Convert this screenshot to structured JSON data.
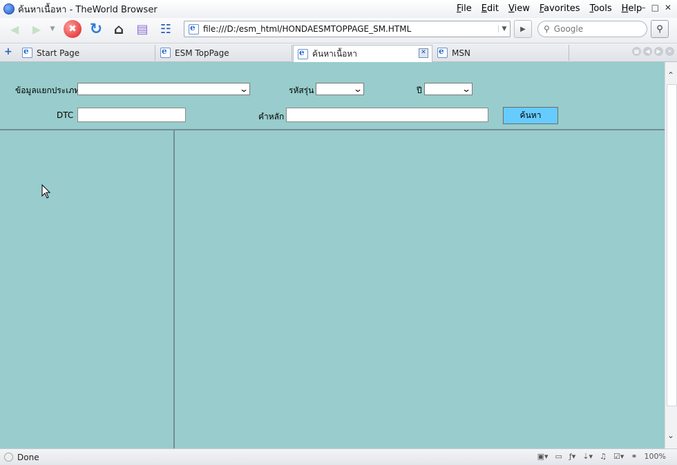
{
  "window": {
    "title": "ค้นหาเนื้อหา - TheWorld Browser",
    "menu": [
      "File",
      "Edit",
      "View",
      "Favorites",
      "Tools",
      "Help"
    ]
  },
  "toolbar": {
    "address": "file:///D:/esm_html/HONDAESMTOPPAGE_SM.HTML",
    "search_placeholder": "Google"
  },
  "tabs": [
    {
      "label": "Start Page"
    },
    {
      "label": "ESM TopPage"
    },
    {
      "label": "ค้นหาเนื้อหา"
    },
    {
      "label": "MSN"
    }
  ],
  "form": {
    "category_label": "ข้อมูลแยกประเภท",
    "model_code_label": "รหัสรุ่น",
    "year_label": "ปี",
    "dtc_label": "DTC",
    "keyword_label": "คำหลัก",
    "search_button": "ค้นหา"
  },
  "status": {
    "text": "Done",
    "zoom": "100%"
  }
}
